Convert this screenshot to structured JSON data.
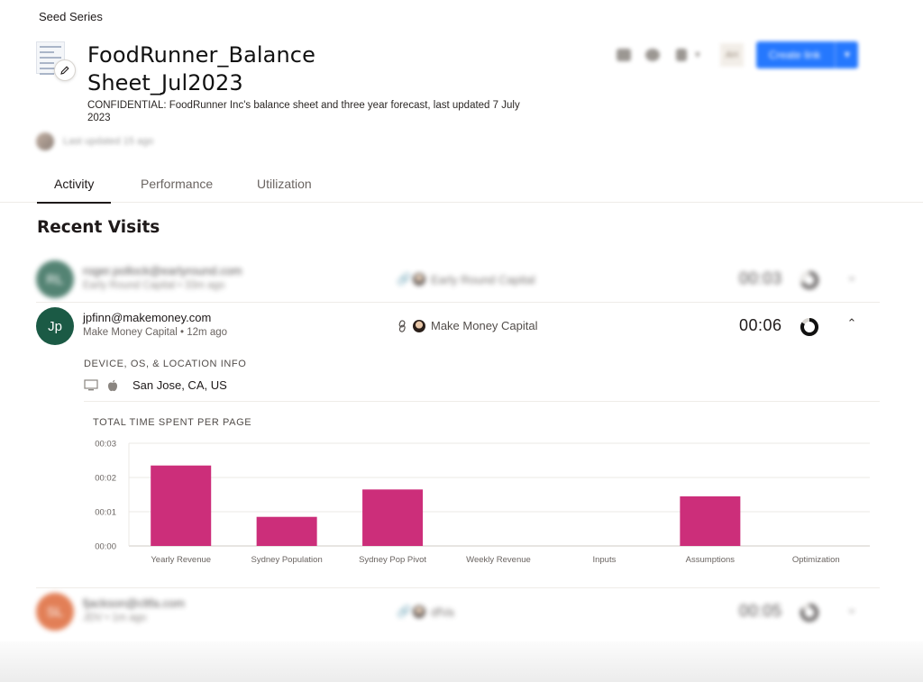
{
  "breadcrumb": "Seed Series",
  "document": {
    "title": "FoodRunner_Balance Sheet_Jul2023",
    "description": "CONFIDENTIAL: FoodRunner Inc's balance sheet and three year forecast, last updated 7 July 2023",
    "updated_text": "Last updated 15 ago"
  },
  "toolbar": {
    "initials": "AH",
    "create_label": "Create link",
    "icons": [
      "comment-icon",
      "preview-icon",
      "more-menu-icon"
    ]
  },
  "tabs": [
    {
      "label": "Activity",
      "active": true
    },
    {
      "label": "Performance",
      "active": false
    },
    {
      "label": "Utilization",
      "active": false
    }
  ],
  "section_title": "Recent Visits",
  "visits": [
    {
      "initials": "RL",
      "email": "roger.pollock@earlyround.com",
      "org": "Early Round Capital",
      "ago": "33m ago",
      "link_name": "Early Round Capital",
      "time": "00:03",
      "avatar_color": "#1b5a45",
      "completion": 0.65,
      "expanded": false
    },
    {
      "initials": "Jp",
      "email": "jpfinn@makemoney.com",
      "org": "Make Money Capital",
      "ago": "12m ago",
      "link_name": "Make Money Capital",
      "time": "00:06",
      "avatar_color": "#1b5a45",
      "completion": 0.78,
      "expanded": true
    },
    {
      "initials": "SL",
      "email": "fjackson@cltfa.com",
      "org": "JDV",
      "ago": "1m ago",
      "link_name": "dfVa",
      "time": "00:05",
      "avatar_color": "#d9551f",
      "completion": 0.7,
      "expanded": false
    }
  ],
  "device": {
    "heading": "DEVICE, OS, & LOCATION INFO",
    "location": "San Jose, CA, US",
    "icons": [
      "desktop-icon",
      "apple-icon"
    ]
  },
  "chart_data": {
    "type": "bar",
    "title": "TOTAL TIME SPENT PER PAGE",
    "categories": [
      "Yearly Revenue",
      "Sydney Population",
      "Sydney Pop Pivot",
      "Weekly Revenue",
      "Inputs",
      "Assumptions",
      "Optimization"
    ],
    "values": [
      2.35,
      0.85,
      1.65,
      0,
      0,
      1.45,
      0
    ],
    "value_unit": "seconds",
    "y_ticks": [
      "00:00",
      "00:01",
      "00:02",
      "00:03"
    ],
    "ylim": [
      0,
      3
    ],
    "grid": true,
    "bar_color": "#cc2e7a"
  }
}
